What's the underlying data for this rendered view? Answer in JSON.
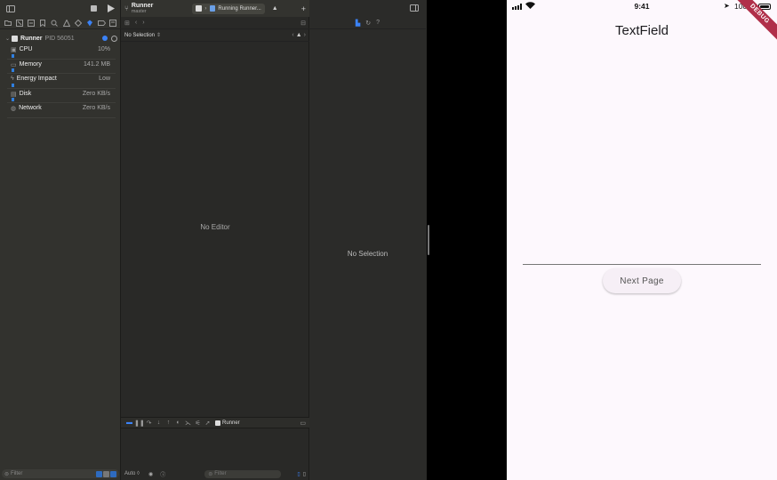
{
  "xcode": {
    "scheme": {
      "name": "Runner",
      "branch": "master"
    },
    "activity": {
      "target": "Running Runner..."
    },
    "navigator": {
      "process": {
        "name": "Runner",
        "pid": "PID 56051"
      },
      "gauges": [
        {
          "label": "CPU",
          "value": "10%",
          "icon": "cpu-icon"
        },
        {
          "label": "Memory",
          "value": "141.2 MB",
          "icon": "memory-icon"
        },
        {
          "label": "Energy Impact",
          "value": "Low",
          "icon": "energy-icon"
        },
        {
          "label": "Disk",
          "value": "Zero KB/s",
          "icon": "disk-icon"
        },
        {
          "label": "Network",
          "value": "Zero KB/s",
          "icon": "network-icon"
        }
      ],
      "filter_placeholder": "Filter"
    },
    "editor": {
      "jump_bar": "No Selection",
      "empty_message": "No Editor"
    },
    "debug_bar": {
      "process": "Runner"
    },
    "console": {
      "scope": "Auto ◊",
      "filter_placeholder": "Filter"
    },
    "inspector": {
      "empty_message": "No Selection"
    }
  },
  "simulator": {
    "status": {
      "time": "9:41",
      "battery": "100%"
    },
    "banner": "DEBUG",
    "app_title": "TextField",
    "text_field_value": "",
    "button_label": "Next Page"
  },
  "colors": {
    "accent": "#3b82f6",
    "banner": "#b0304a"
  }
}
